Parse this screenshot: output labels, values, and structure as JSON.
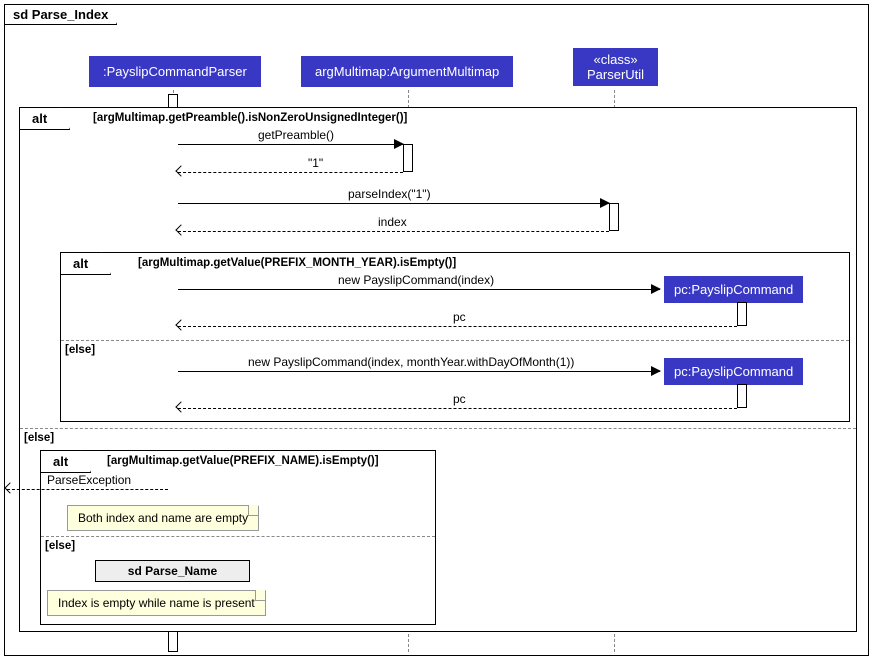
{
  "diagram": {
    "title": "sd Parse_Index",
    "participants": {
      "parser": ":PayslipCommandParser",
      "multimap": "argMultimap:ArgumentMultimap",
      "util_stereotype": "«class»",
      "util_name": "ParserUtil",
      "pc1": "pc:PayslipCommand",
      "pc2": "pc:PayslipCommand"
    },
    "fragments": {
      "alt1": "alt",
      "alt1_guard": "[argMultimap.getPreamble().isNonZeroUnsignedInteger()]",
      "alt2": "alt",
      "alt2_guard": "[argMultimap.getValue(PREFIX_MONTH_YEAR).isEmpty()]",
      "alt3": "alt",
      "alt3_guard": "[argMultimap.getValue(PREFIX_NAME).isEmpty()]",
      "else1": "[else]",
      "else2": "[else]",
      "else3": "[else]",
      "ref": "sd Parse_Name"
    },
    "messages": {
      "getPreamble": "getPreamble()",
      "getPreamble_ret": "\"1\"",
      "parseIndex": "parseIndex(\"1\")",
      "parseIndex_ret": "index",
      "newPc1": "new PayslipCommand(index)",
      "newPc1_ret": "pc",
      "newPc2": "new PayslipCommand(index, monthYear.withDayOfMonth(1))",
      "newPc2_ret": "pc",
      "parseException": "ParseException"
    },
    "notes": {
      "note1": "Both index and name are empty",
      "note2": "Index is empty while name is present"
    }
  }
}
